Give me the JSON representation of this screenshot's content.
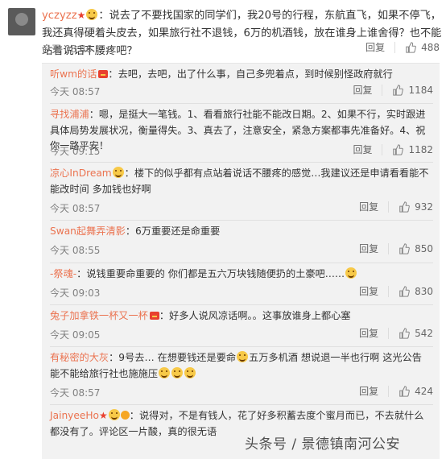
{
  "main_comment": {
    "username": "yczyzz",
    "text": "：说去了不要找国家的同学们，我20号的行程，东航直飞，如果不停飞，我还真得硬着头皮去，如果旅行社不退钱，6万的机酒钱，放在谁身上谁舍得？也不能站着说话不腰疼吧？",
    "time": "今天 08:46",
    "reply_label": "回复",
    "likes": "488"
  },
  "replies": [
    {
      "name": "听wm的话",
      "text": "：去吧，去吧，出了什么事，自己多兜着点，到时候别怪政府就行",
      "time": "今天 08:57",
      "reply_label": "回复",
      "likes": "1184"
    },
    {
      "name": "寻找浦浦",
      "text": "：嗯，是挺大一笔钱。1、看看旅行社能不能改日期。2、如果不行，实时跟进具体局势发展状况，衡量得失。3、真去了，注意安全，紧急方案都事先准备好。4、祝你一路平安！",
      "time": "今天 09:15",
      "reply_label": "回复",
      "likes": "1182"
    },
    {
      "name": "凉心InDream",
      "text": "：楼下的似乎都有点站着说话不腰疼的感觉…我建议还是申请看看能不能改时间 多加钱也好啊",
      "time": "今天 08:57",
      "reply_label": "回复",
      "likes": "932"
    },
    {
      "name": "Swan起舞弄清影",
      "text": "：6万重要还是命重要",
      "time": "今天 08:55",
      "reply_label": "回复",
      "likes": "850"
    },
    {
      "name": "-祭魂-",
      "text": "：说钱重要命重要的 你们都是五六万块钱随便扔的土豪吧……",
      "time": "今天 09:03",
      "reply_label": "回复",
      "likes": "830"
    },
    {
      "name": "兔子加拿铁一杯又一杯",
      "text": "：好多人说风凉话啊。。这事放谁身上都心塞",
      "time": "今天 09:05",
      "reply_label": "回复",
      "likes": "542"
    },
    {
      "name": "有秘密的大灰",
      "text": "：9号去… 在想要钱还是要命",
      "text2": "五万多机酒 想说退一半也行啊 这光公告 能不能给旅行社也施施压",
      "time": "今天 08:57",
      "reply_label": "回复",
      "likes": "424"
    },
    {
      "name": "JainyeeHo",
      "text": "：说得对，不是有钱人，花了好多积蓄去度个蜜月而已，不去就什么都没有了。评论区一片酸，真的很无语",
      "time": "",
      "reply_label": "",
      "likes": ""
    }
  ],
  "watermark": "头条号 / 景德镇南河公安"
}
